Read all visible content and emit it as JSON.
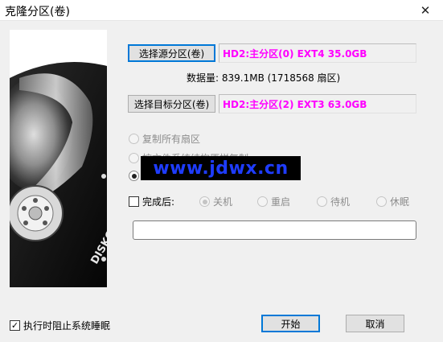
{
  "window": {
    "title": "克隆分区(卷)",
    "close_glyph": "✕"
  },
  "brand": {
    "logo_text": "DISKGENIUS"
  },
  "source": {
    "button_label": "选择源分区(卷)",
    "partition": "HD2:主分区(0) EXT4 35.0GB"
  },
  "data_size": "数据量: 839.1MB (1718568 扇区)",
  "target": {
    "button_label": "选择目标分区(卷)",
    "partition": "HD2:主分区(2) EXT3 63.0GB"
  },
  "copy_modes": [
    {
      "label": "复制所有扇区",
      "enabled": false,
      "selected": false
    },
    {
      "label": "按文件系统结构原样复制",
      "enabled": false,
      "selected": false
    },
    {
      "label": "",
      "enabled": true,
      "selected": true
    }
  ],
  "watermark": "www.jdwx.cn",
  "after_completion": {
    "label": "完成后:",
    "checked": false,
    "options": [
      {
        "label": "关机",
        "selected": true
      },
      {
        "label": "重启",
        "selected": false
      },
      {
        "label": "待机",
        "selected": false
      },
      {
        "label": "休眠",
        "selected": false
      }
    ]
  },
  "options": {
    "prevent_sleep_label": "执行时阻止系统睡眠",
    "prevent_sleep_checked": true
  },
  "buttons": {
    "start": "开始",
    "cancel": "取消"
  },
  "colors": {
    "partition_text": "#ff00ff",
    "watermark_text": "#1e3cff",
    "accent": "#0078d7"
  }
}
